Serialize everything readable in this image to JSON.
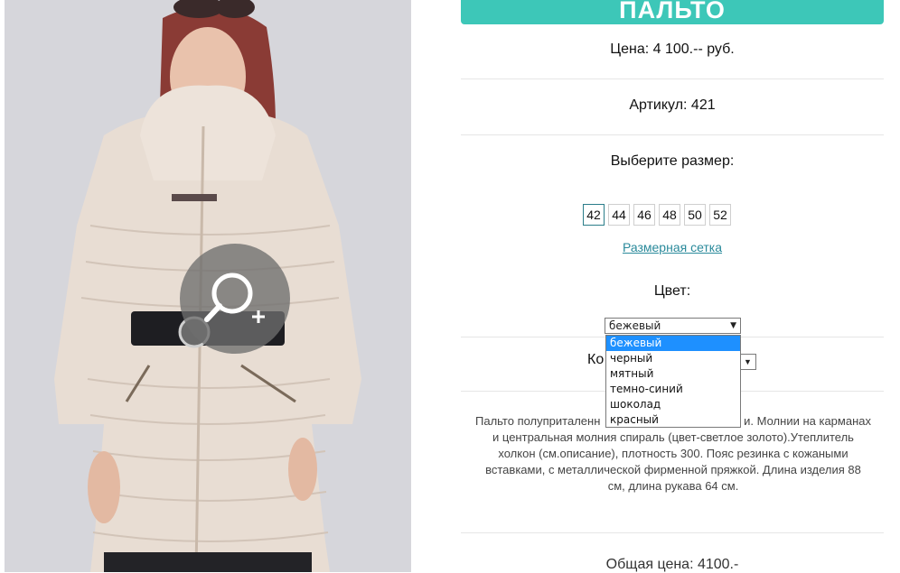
{
  "product": {
    "title": "ПАЛЬТО",
    "price": "Цена: 4 100.-- руб.",
    "sku": "Артикул: 421",
    "choose_size": "Выберите размер:",
    "sizes": [
      "42",
      "44",
      "46",
      "48",
      "50",
      "52"
    ],
    "selected_size": "42",
    "size_chart_link": "Размерная сетка",
    "color_label": "Цвет:",
    "color_selected": "бежевый",
    "color_options": [
      "бежевый",
      "черный",
      "мятный",
      "темно-синий",
      "шоколад",
      "красный"
    ],
    "qty_label_partial": "Ко",
    "description_line1_left": "Пальто полуприталенн",
    "description_line1_right": "и. Молнии на карманах",
    "description_rest": "и центральная молния спираль (цвет-светлое золото).Утеплитель холкон (см.описание), плотность 300. Пояс резинка с кожаными вставками, с металлической фирменной пряжкой. Длина изделия 88 см, длина рукава 64 см.",
    "total": "Общая цена: 4100.-"
  },
  "colors": {
    "accent": "#3dc7b8",
    "link": "#2a8a9b",
    "dropdown_highlight": "#1e90ff",
    "coat": "#e8ddd3"
  },
  "icons": {
    "zoom": "zoom-in-icon",
    "select_arrow": "▼"
  }
}
